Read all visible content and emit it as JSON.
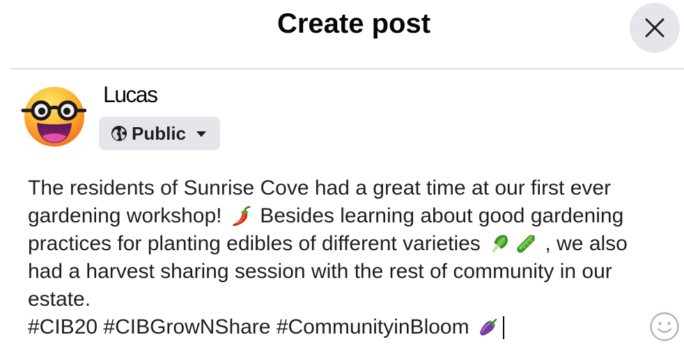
{
  "dialog": {
    "title": "Create post",
    "close_icon": "close-icon"
  },
  "author": {
    "name": "Lucas",
    "avatar_icon": "nerd-face-avatar-icon"
  },
  "audience_selector": {
    "label": "Public",
    "icon": "globe-icon",
    "dropdown_icon": "caret-down-icon"
  },
  "post": {
    "lines": [
      [
        {
          "text": "The residents of Sunrise Cove had a great time at our first ever"
        }
      ],
      [
        {
          "text": "gardening workshop! "
        },
        {
          "emoji": "hot-pepper-icon"
        },
        {
          "text": " Besides learning about good gardening"
        }
      ],
      [
        {
          "text": "practices for planting edibles of different varieties "
        },
        {
          "emoji": "leafy-green-icon"
        },
        {
          "emoji": "cucumber-icon"
        },
        {
          "text": " , we also"
        }
      ],
      [
        {
          "text": "had a harvest sharing session with the rest of community in our"
        }
      ],
      [
        {
          "text": "estate."
        }
      ],
      [
        {
          "text": "#CIB20 #CIBGrowNShare #CommunityinBloom "
        },
        {
          "emoji": "eggplant-icon"
        }
      ]
    ]
  },
  "composer": {
    "emoji_picker_icon": "smiley-icon"
  },
  "colors": {
    "text": "#1c1e21",
    "heading": "#050505",
    "secondary_bg": "#e4e6eb",
    "divider": "#dadde1",
    "icon_gray": "#b0b3b8"
  }
}
